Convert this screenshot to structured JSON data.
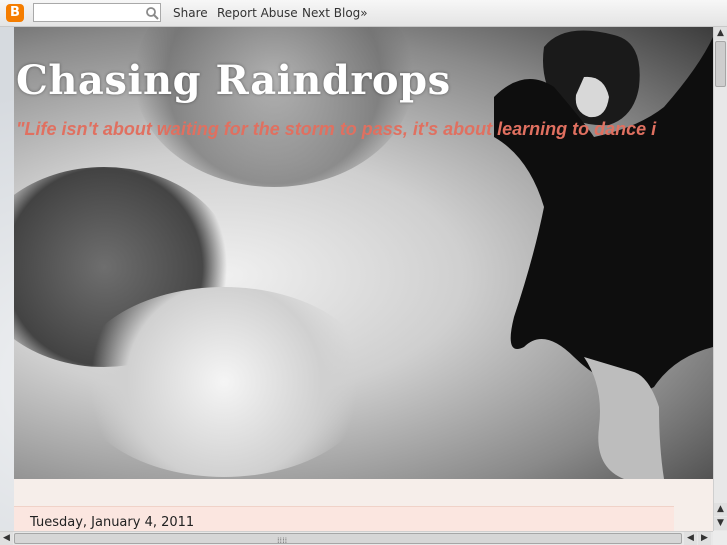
{
  "navbar": {
    "logo_letter": "B",
    "search_placeholder": "",
    "links": [
      "Share",
      "Report Abuse",
      "Next Blog»"
    ]
  },
  "header": {
    "title": "Chasing Raindrops",
    "description": "\"Life isn't about waiting for the storm to pass, it's about learning to dance i"
  },
  "post": {
    "date": "Tuesday, January 4, 2011"
  },
  "colors": {
    "title": "#ffffff",
    "description": "#e07060",
    "date_header_bg": "#fbe6e0",
    "logo": "#f57d00"
  },
  "icons": {
    "logo": "blogger-icon",
    "search": "search-icon"
  }
}
